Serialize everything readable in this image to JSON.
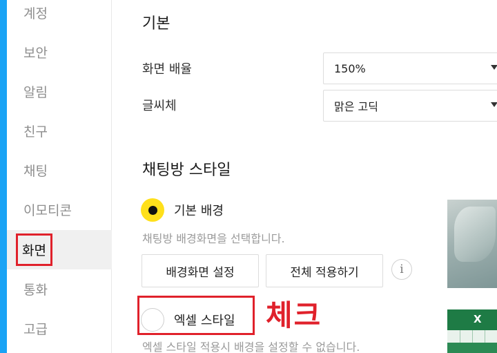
{
  "sidebar": {
    "items": [
      {
        "label": "계정",
        "active": false
      },
      {
        "label": "보안",
        "active": false
      },
      {
        "label": "알림",
        "active": false
      },
      {
        "label": "친구",
        "active": false
      },
      {
        "label": "채팅",
        "active": false
      },
      {
        "label": "이모티콘",
        "active": false
      },
      {
        "label": "화면",
        "active": true
      },
      {
        "label": "통화",
        "active": false
      },
      {
        "label": "고급",
        "active": false
      }
    ]
  },
  "basic": {
    "title": "기본",
    "zoom": {
      "label": "화면 배율",
      "value": "150%"
    },
    "font": {
      "label": "글씨체",
      "value": "맑은 고딕"
    }
  },
  "chatroom_style": {
    "title": "채팅방 스타일",
    "default_bg": {
      "label": "기본 배경",
      "selected": true,
      "hint": "채팅방 배경화면을 선택합니다."
    },
    "buttons": {
      "set_wallpaper": "배경화면 설정",
      "apply_all": "전체 적용하기",
      "info": "i"
    },
    "excel_style": {
      "label": "엑셀 스타일",
      "selected": false,
      "hint": "엑셀 스타일 적용시 배경을 설정할 수 없습니다."
    },
    "excel_preview_header": "X"
  },
  "annotation": {
    "text": "체크",
    "color": "#e0212b"
  },
  "colors": {
    "accent_yellow": "#ffe01b",
    "window_edge": "#1aa3f5",
    "excel_green": "#1e7b45"
  }
}
